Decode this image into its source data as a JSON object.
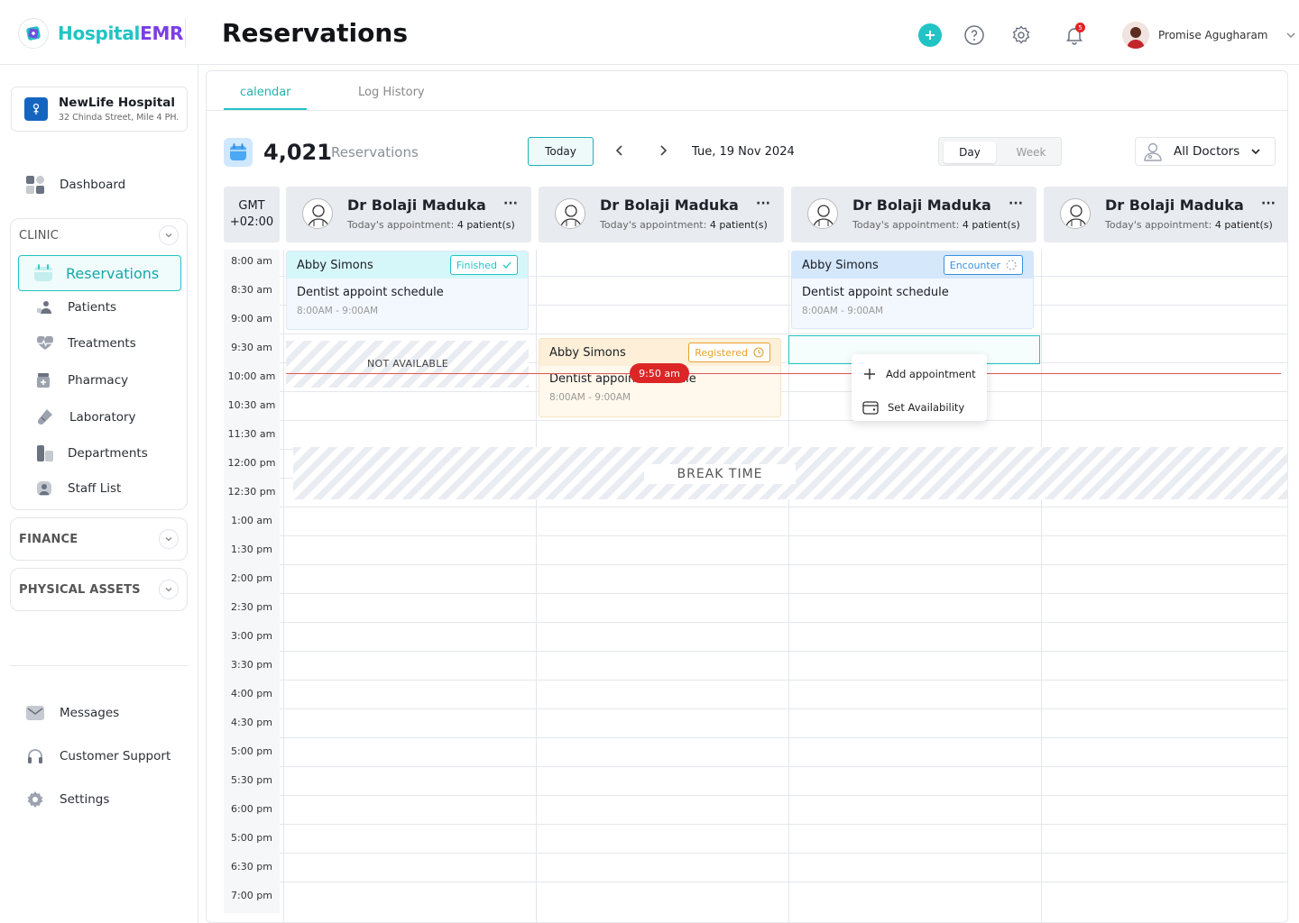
{
  "app": {
    "logo_part1": "Hospital",
    "logo_part2": "EMR",
    "page_title": "Reservations"
  },
  "header": {
    "notification_count": "5",
    "user_name": "Promise Agugharam"
  },
  "hospital": {
    "name": "NewLife Hospital",
    "address": "32 Chinda Street, Mile 4 PH."
  },
  "sidebar": {
    "dashboard": "Dashboard",
    "clinic": {
      "title": "CLINIC",
      "items": [
        "Reservations",
        "Patients",
        "Treatments",
        "Pharmacy",
        "Laboratory",
        "Departments",
        "Staff List"
      ]
    },
    "finance": "FINANCE",
    "physical_assets": "PHYSICAL ASSETS",
    "bottom": [
      "Messages",
      "Customer Support",
      "Settings"
    ]
  },
  "tabs": [
    "calendar",
    "Log History"
  ],
  "toolbar": {
    "count": "4,021",
    "count_label": "Reservations",
    "today": "Today",
    "date": "Tue, 19 Nov 2024",
    "view_day": "Day",
    "view_week": "Week",
    "doctor_filter": "All Doctors"
  },
  "timezone": {
    "line1": "GMT",
    "line2": "+02:00"
  },
  "doctors": [
    {
      "name": "Dr Bolaji Maduka",
      "appt_label": "Today's appointment:",
      "appt_count": "4 patient(s)"
    },
    {
      "name": "Dr Bolaji Maduka",
      "appt_label": "Today's appointment:",
      "appt_count": "4 patient(s)"
    },
    {
      "name": "Dr Bolaji Maduka",
      "appt_label": "Today's appointment:",
      "appt_count": "4 patient(s)"
    },
    {
      "name": "Dr Bolaji Maduka",
      "appt_label": "Today's appointment:",
      "appt_count": "4 patient(s)"
    }
  ],
  "time_slots": [
    "8:00 am",
    "8:30 am",
    "9:00 am",
    "9:30 am",
    "10:00 am",
    "10:30 am",
    "11:30 am",
    "12:00 pm",
    "12:30 pm",
    "1:00 am",
    "1:30 pm",
    "2:00 pm",
    "2:30 pm",
    "3:00 pm",
    "3:30 pm",
    "4:00 pm",
    "4:30 pm",
    "5:00 pm",
    "5:30 pm",
    "6:00 pm",
    "5:00 pm",
    "6:30 pm",
    "7:00 pm"
  ],
  "appointments": [
    {
      "patient": "Abby Simons",
      "status": "Finished",
      "title": "Dentist appoint schedule",
      "time": "8:00AM - 9:00AM",
      "colors": {
        "head": "#d6f7fa",
        "body": "#f3f8fe",
        "badge": "#21c4c4"
      }
    },
    {
      "patient": "Abby Simons",
      "status": "Registered",
      "title": "Dentist appoint schedule",
      "time": "8:00AM - 9:00AM",
      "colors": {
        "head": "#fdefd8",
        "body": "#fff8ec",
        "badge": "#e8a02f"
      }
    },
    {
      "patient": "Abby Simons",
      "status": "Encounter",
      "title": "Dentist appoint schedule",
      "time": "8:00AM - 9:00AM",
      "colors": {
        "head": "#d4e7fb",
        "body": "#f3f8fe",
        "badge": "#3b8fe0"
      }
    }
  ],
  "not_available": "NOT AVAILABLE",
  "break_time": "BREAK TIME",
  "current_time": "9:50 am",
  "context_menu": [
    "Add appointment",
    "Set Availability"
  ],
  "accent_color": "#21c4c4"
}
